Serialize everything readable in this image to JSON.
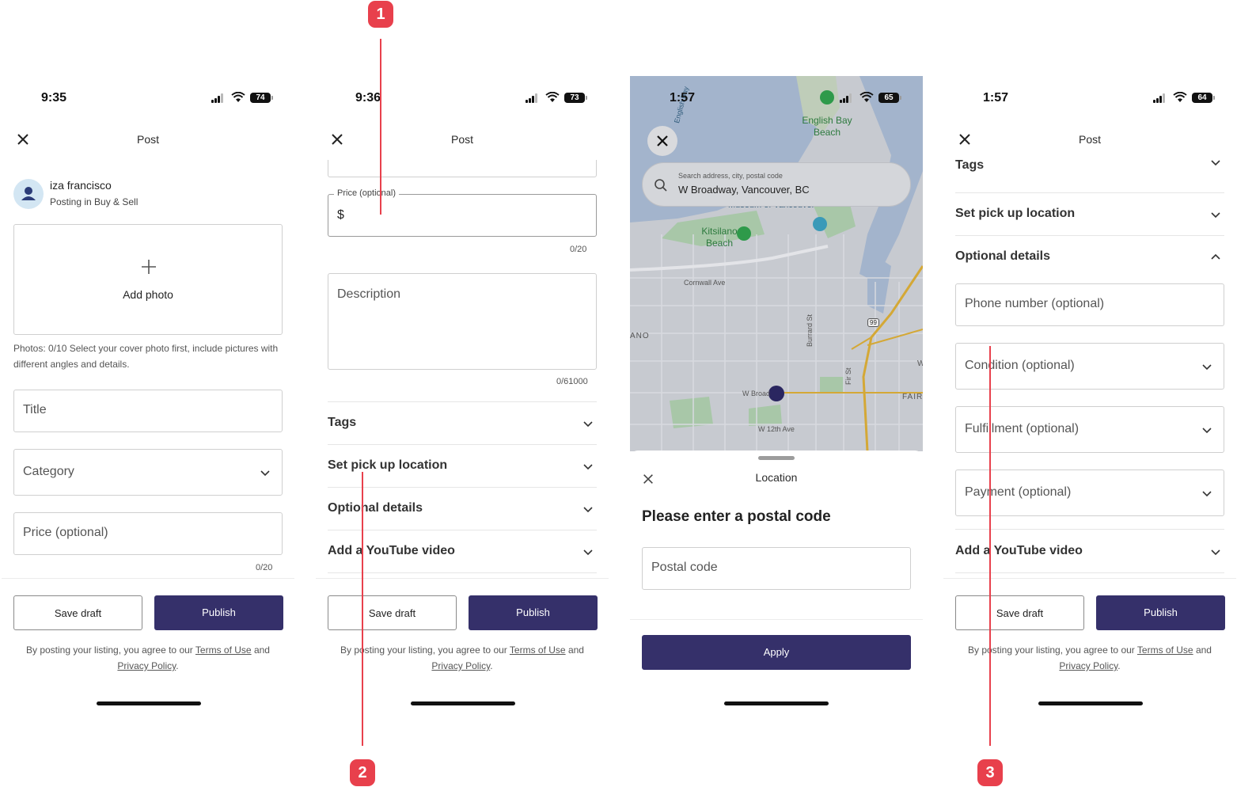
{
  "screens": [
    {
      "time": "9:35",
      "battery": "74",
      "nav_title": "Post",
      "user_name": "iza francisco",
      "user_context": "Posting in Buy & Sell",
      "add_photo_label": "Add photo",
      "photos_hint": "Photos: 0/10 Select your cover photo first, include pictures with different angles and details.",
      "title_placeholder": "Title",
      "category_placeholder": "Category",
      "price_placeholder": "Price (optional)",
      "price_counter": "0/20",
      "save_draft_label": "Save draft",
      "publish_label": "Publish",
      "legal_prefix": "By posting your listing, you agree to our",
      "terms_link": "Terms of Use",
      "legal_and": "and",
      "privacy_link": "Privacy Policy",
      "legal_end": "."
    },
    {
      "time": "9:36",
      "battery": "73",
      "nav_title": "Post",
      "price_legend": "Price (optional)",
      "currency_symbol": "$",
      "price_counter": "0/20",
      "description_placeholder": "Description",
      "description_counter": "0/61000",
      "sections": [
        "Tags",
        "Set pick up location",
        "Optional details",
        "Add a YouTube video"
      ],
      "save_draft_label": "Save draft",
      "publish_label": "Publish",
      "legal_prefix": "By posting your listing, you agree to our",
      "terms_link": "Terms of Use",
      "legal_and": "and",
      "privacy_link": "Privacy Policy",
      "legal_end": "."
    },
    {
      "time": "1:57",
      "battery": "65",
      "search_label": "Search address, city, postal code",
      "search_value": "W Broadway, Vancouver, BC",
      "map_labels": {
        "english_bay": "English Bay",
        "english_bay_beach": "English Bay Beach",
        "museum": "Museum of Vancouver",
        "kitsilano_beach": "Kitsilano Beach",
        "cornwall": "Cornwall Ave",
        "burrard": "Burrard St",
        "fir": "Fir St",
        "w_broadway": "W Broad",
        "w12": "W 12th Ave",
        "highway": "99",
        "ano": "ANO",
        "fair": "FAIR",
        "w_edge": "W"
      },
      "sheet_title": "Location",
      "heading": "Please enter a postal code",
      "postal_placeholder": "Postal code",
      "apply_label": "Apply"
    },
    {
      "time": "1:57",
      "battery": "64",
      "nav_title": "Post",
      "partial_section": "Tags",
      "pickup_label": "Set pick up location",
      "optional_label": "Optional details",
      "phone_placeholder": "Phone number (optional)",
      "condition_placeholder": "Condition (optional)",
      "fulfillment_placeholder": "Fulfillment (optional)",
      "payment_placeholder": "Payment (optional)",
      "youtube_label": "Add a YouTube video",
      "save_draft_label": "Save draft",
      "publish_label": "Publish",
      "legal_prefix": "By posting your listing, you agree to our",
      "terms_link": "Terms of Use",
      "legal_and": "and",
      "privacy_link": "Privacy Policy",
      "legal_end": "."
    }
  ],
  "annotations": [
    "1",
    "2",
    "3"
  ],
  "colors": {
    "primary": "#35306a",
    "annotation": "#e8404c",
    "map_water": "#a3b4cc",
    "map_park": "#a8c7a8",
    "map_road": "#d4a836"
  }
}
